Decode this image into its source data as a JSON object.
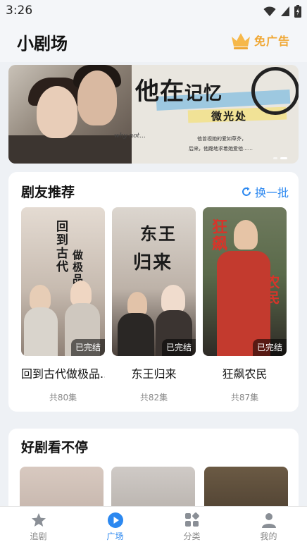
{
  "status_bar": {
    "time": "3:26"
  },
  "header": {
    "title": "小剧场",
    "ad_free_label": "免广告"
  },
  "banner": {
    "title_big": "他在",
    "title_small": "记忆",
    "subtitle": "微光处",
    "script_text": "why not...",
    "line1": "他曾视她的爱如草芥，",
    "line2": "后来，他跪地求着她爱他……"
  },
  "recommend": {
    "title": "剧友推荐",
    "refresh_label": "换一批",
    "items": [
      {
        "name": "回到古代做极品...",
        "status": "已完结",
        "episodes": "共80集",
        "poster_text_a": "回到古代",
        "poster_text_b": "做极品家丁"
      },
      {
        "name": "东王归来",
        "status": "已完结",
        "episodes": "共82集",
        "poster_text_a": "东王",
        "poster_text_b": "归来"
      },
      {
        "name": "狂飙农民",
        "status": "已完结",
        "episodes": "共87集",
        "poster_text_a": "狂飙",
        "poster_text_b": "农民"
      }
    ]
  },
  "nonstop": {
    "title": "好剧看不停"
  },
  "tabs": [
    {
      "label": "追剧",
      "icon": "star-icon",
      "active": false
    },
    {
      "label": "广场",
      "icon": "play-circle-icon",
      "active": true
    },
    {
      "label": "分类",
      "icon": "category-grid-icon",
      "active": false
    },
    {
      "label": "我的",
      "icon": "user-icon",
      "active": false
    }
  ],
  "colors": {
    "accent": "#2c88f0",
    "gold": "#f0a733",
    "background": "#eef1f5"
  }
}
